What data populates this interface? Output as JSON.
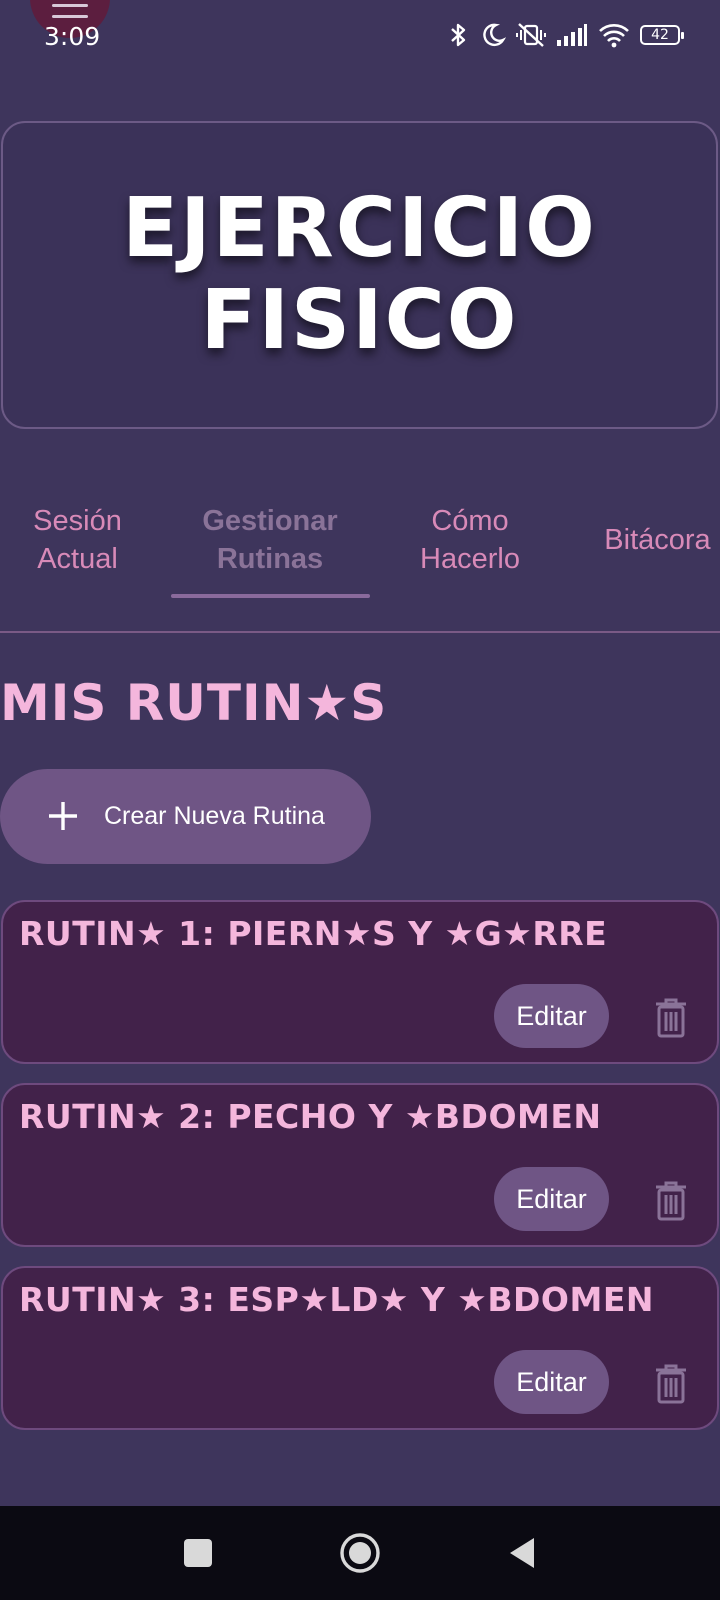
{
  "status_bar": {
    "time": "3:09",
    "battery": "42",
    "icons": [
      "bluetooth-icon",
      "moon-icon",
      "vibrate-off-icon",
      "signal-icon",
      "wifi-icon",
      "battery-icon"
    ]
  },
  "menu": {
    "icon": "hamburger-menu-icon"
  },
  "header": {
    "title": "EJERCICIO FISICO"
  },
  "tabs": [
    {
      "label": "Sesión Actual",
      "active": false
    },
    {
      "label": "Gestionar Rutinas",
      "active": true
    },
    {
      "label": "Cómo Hacerlo",
      "active": false
    },
    {
      "label": "Bitácora",
      "active": false
    }
  ],
  "section": {
    "title": "MIS RUTIN★S"
  },
  "create_button": {
    "icon": "plus-icon",
    "label": "Crear Nueva Rutina"
  },
  "routines": [
    {
      "name": "RUTIN★ 1: PIERN★S Y ★G★RRE",
      "edit_label": "Editar",
      "delete_icon": "trash-icon"
    },
    {
      "name": "RUTIN★ 2: PECHO Y ★BDOMEN",
      "edit_label": "Editar",
      "delete_icon": "trash-icon"
    },
    {
      "name": "RUTIN★ 3: ESP★LD★ Y ★BDOMEN",
      "edit_label": "Editar",
      "delete_icon": "trash-icon"
    }
  ],
  "nav_bar": {
    "icons": [
      "recent-apps-icon",
      "home-icon",
      "back-icon"
    ]
  },
  "colors": {
    "background": "#3e355c",
    "card": "#42224a",
    "accent_pink": "#f4b6dc",
    "tab_pink": "#d88ab8",
    "button": "#6f5585"
  }
}
